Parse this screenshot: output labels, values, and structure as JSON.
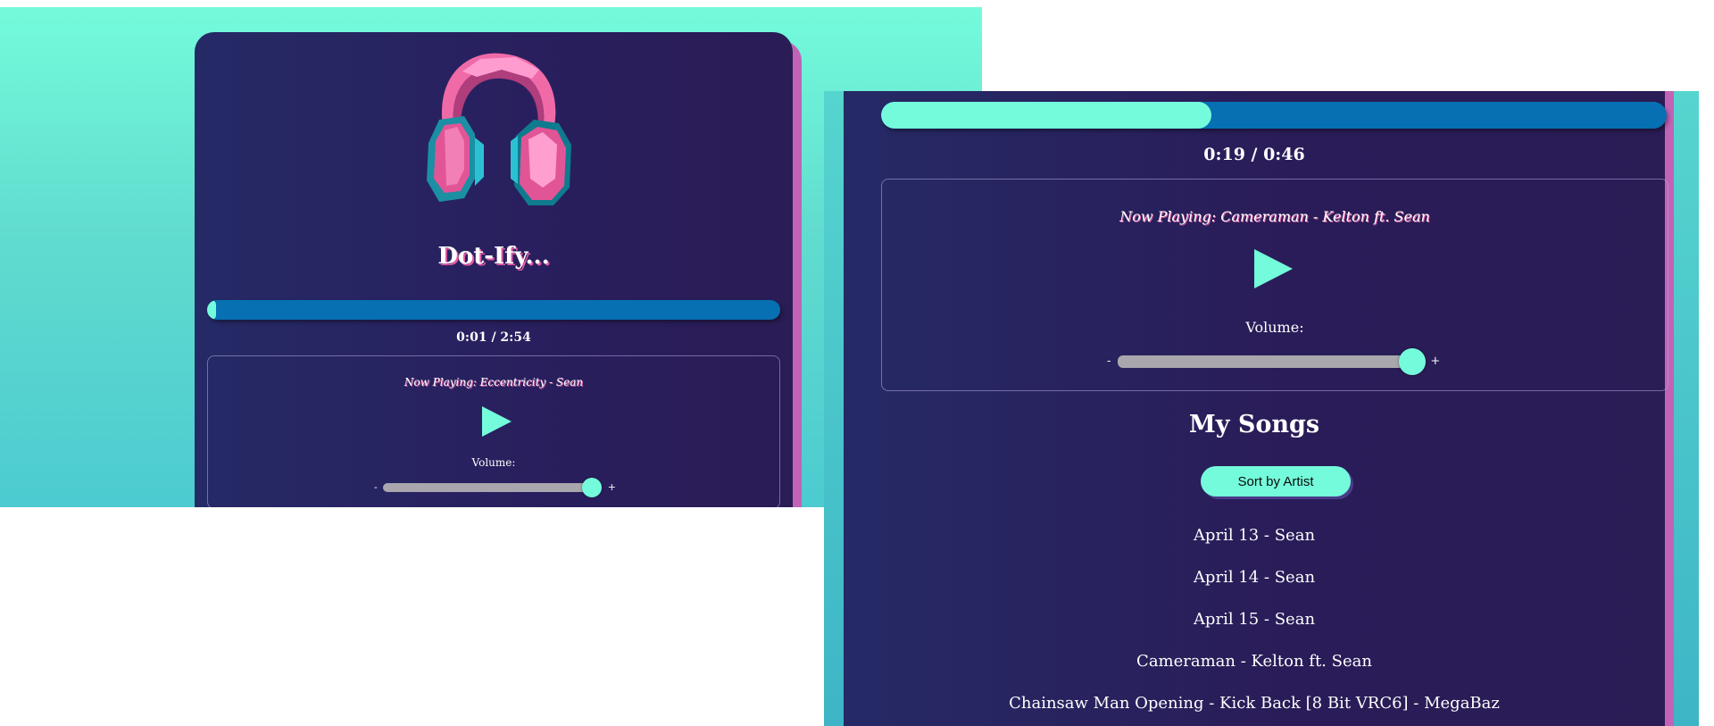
{
  "left": {
    "app_title": "Dot-Ify...",
    "progress_pct": 1.5,
    "time": "0:01 / 2:54",
    "now_playing": "Now Playing: Eccentricity - Sean",
    "volume_label": "Volume:",
    "volume_minus": "-",
    "volume_plus": "+",
    "volume_level": 0.96
  },
  "right": {
    "progress_pct": 42,
    "time": "0:19 / 0:46",
    "now_playing": "Now Playing: Cameraman - Kelton ft. Sean",
    "volume_label": "Volume:",
    "volume_minus": "-",
    "volume_plus": "+",
    "volume_level": 0.97,
    "section_title": "My Songs",
    "sort_button": "Sort by Artist",
    "songs": [
      "April 13 - Sean",
      "April 14 - Sean",
      "April 15 - Sean",
      "Cameraman - Kelton ft. Sean",
      "Chainsaw Man Opening - Kick Back [8 Bit VRC6] - MegaBaz"
    ]
  },
  "colors": {
    "accent_mint": "#74fbdb",
    "progress_track": "#0670b3",
    "card_bg": "#272263",
    "pink_shadow": "#c263b6"
  }
}
